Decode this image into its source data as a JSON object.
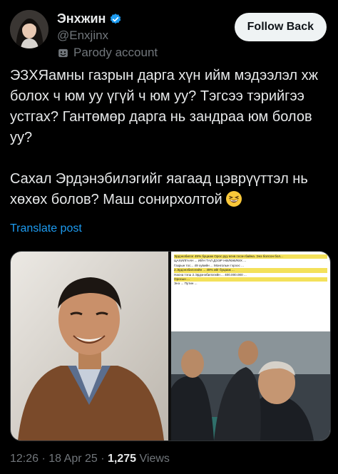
{
  "author": {
    "display_name": "Энхжин",
    "handle": "@Enxjinx",
    "account_label": "Parody account",
    "verified": true
  },
  "follow_button": {
    "label": "Follow Back"
  },
  "tweet": {
    "paragraph1": "ЭЗХЯамны газрын дарга хүн ийм мэдээлэл хж болох ч юм уу үгүй ч юм уу? Тэгсээ тэрийгээ устгах? Гантөмөр дарга нь зандраа юм болов уу?",
    "paragraph2": "Сахал Эрдэнэбилэгийг яагаад цэврүүттэл нь хөхөх болов? Маш сонирхолтой",
    "emoji": "grinning-squinting-face"
  },
  "translate_link": "Translate post",
  "media": {
    "document_lines": [
      "Эрдэнэбилэг 49% буцааж Орос руу өгнө гэсэн байна. Энэ болсон бол...",
      "ЦАХИЛГААН ... ИЙН ТАЛ ДЭЭР НӨЛӨӨЛӨХ ...",
      "Газрын тос... 49 хувийн ... Монголын тэрээс ...",
      "2.Эрдэнэбилэгийн ... 49% ийг буцааж ...",
      "Насна тэгш 2.Эрдэнэбилэгийн ... 400.000.000 ...",
      "Оросын ...",
      "Энэ ... Путин ..."
    ]
  },
  "meta": {
    "time": "12:26",
    "sep1": "·",
    "date": "18 Apr 25",
    "sep2": "·",
    "views_count": "1,275",
    "views_label": "Views"
  },
  "colors": {
    "background": "#000000",
    "text_primary": "#e7e9ea",
    "text_secondary": "#71767b",
    "accent": "#1d9bf0",
    "follow_bg": "#eff3f4"
  }
}
